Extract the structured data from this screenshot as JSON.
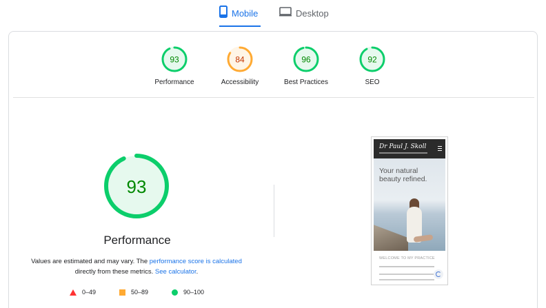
{
  "tabs": [
    {
      "label": "Mobile",
      "icon": "smartphone-icon",
      "active": true
    },
    {
      "label": "Desktop",
      "icon": "monitor-icon",
      "active": false
    }
  ],
  "summary_scores": [
    {
      "label": "Performance",
      "score": "93",
      "value": 93,
      "status": "pass"
    },
    {
      "label": "Accessibility",
      "score": "84",
      "value": 84,
      "status": "average"
    },
    {
      "label": "Best Practices",
      "score": "96",
      "value": 96,
      "status": "pass"
    },
    {
      "label": "SEO",
      "score": "92",
      "value": 92,
      "status": "pass"
    }
  ],
  "performance": {
    "score": "93",
    "value": 93,
    "title": "Performance",
    "desc_prefix": "Values are estimated and may vary. The ",
    "link_score": "performance score is calculated",
    "desc_middle": " directly from these metrics. ",
    "link_calculator": "See calculator",
    "desc_suffix": "."
  },
  "legend": [
    {
      "range": "0–49",
      "shape": "triangle",
      "color": "#ff3333"
    },
    {
      "range": "50–89",
      "shape": "square",
      "color": "#ffaa33"
    },
    {
      "range": "90–100",
      "shape": "circle",
      "color": "#0cce6b"
    }
  ],
  "screenshot": {
    "brand": "Dr Paul J. Skoll",
    "hero_text": "Your natural beauty refined.",
    "welcome": "WELCOME TO MY PRACTICE"
  },
  "colors": {
    "pass": "#0cce6b",
    "pass_text": "#008800",
    "pass_bg": "#e6f9ee",
    "average": "#ffaa33",
    "average_text": "#c33300",
    "average_bg": "#fff5e6",
    "accent": "#1a73e8"
  }
}
